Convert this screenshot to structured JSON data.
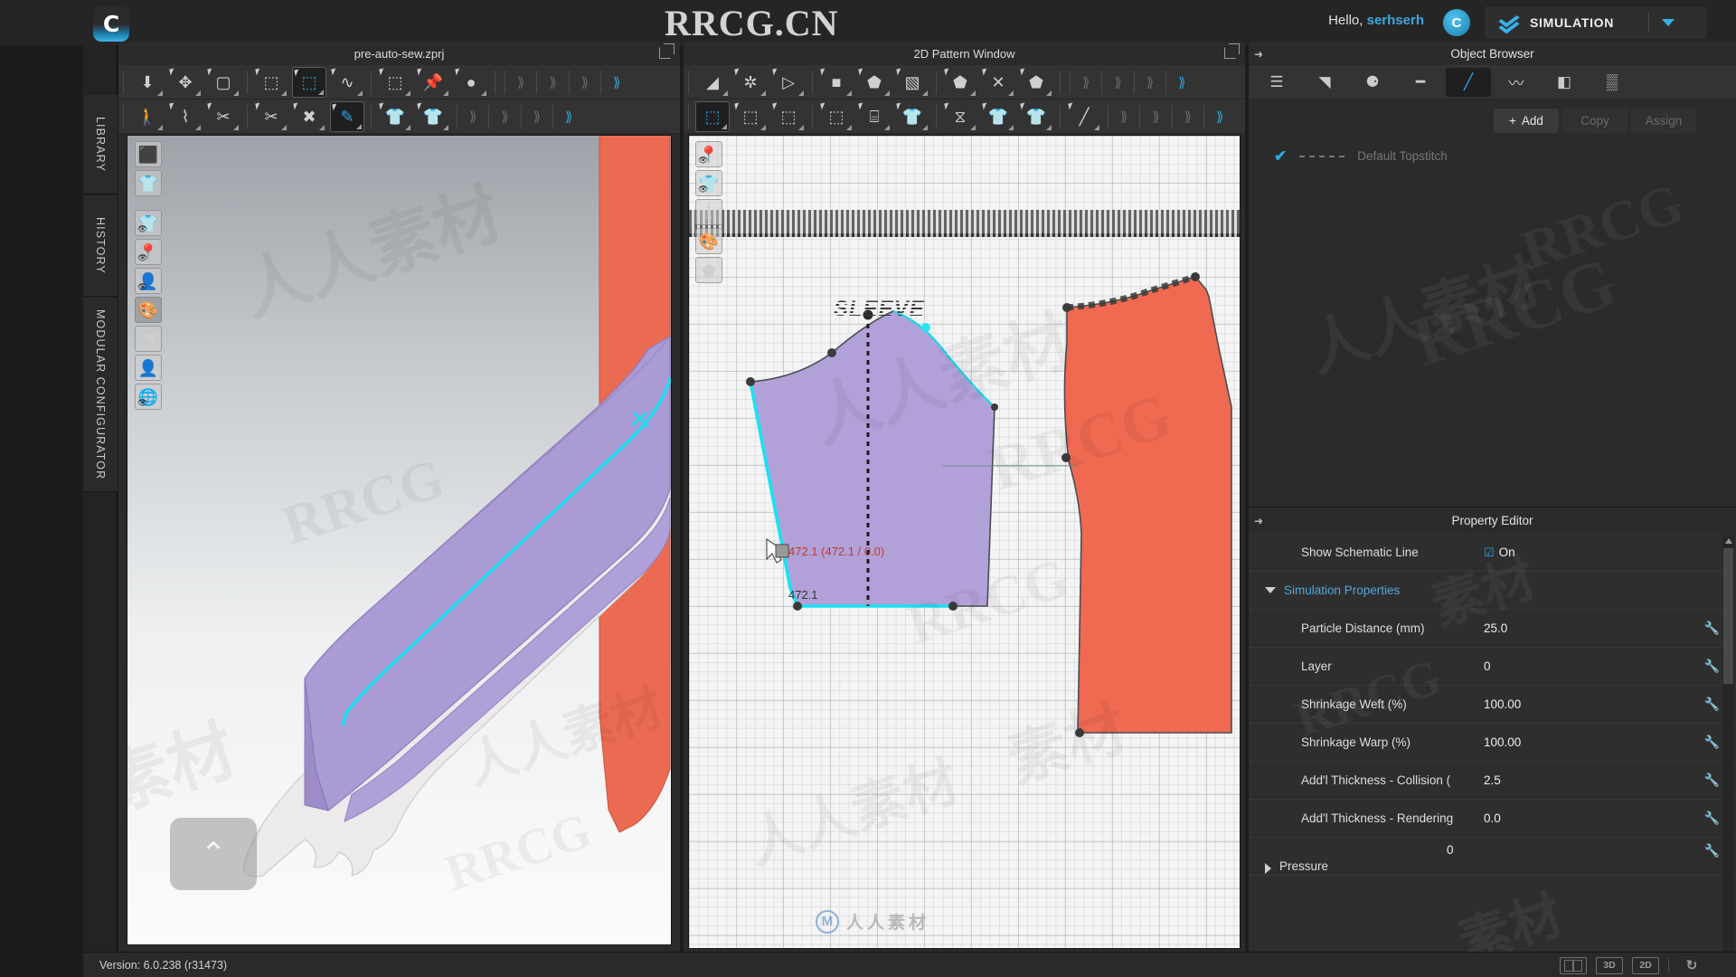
{
  "app": {
    "logo_glyph": "C",
    "greeting_prefix": "Hello,",
    "username": "serhserh",
    "avatar_glyph": "C",
    "simulation_label": "SIMULATION",
    "watermark_top": "RRCG.CN"
  },
  "left_rail": {
    "tabs": [
      {
        "label": "LIBRARY"
      },
      {
        "label": "HISTORY"
      },
      {
        "label": "MODULAR CONFIGURATOR"
      }
    ]
  },
  "panel_3d": {
    "title": "pre-auto-sew.zprj",
    "toolbar_row1": [
      {
        "name": "sync-import-icon",
        "glyph": "⬇"
      },
      {
        "name": "transform-move-icon",
        "glyph": "✥"
      },
      {
        "name": "select-box-icon",
        "glyph": "▢"
      },
      {
        "name": "edit-pattern-icon",
        "glyph": "⬚"
      },
      {
        "name": "segment-sewing-icon",
        "glyph": "⬚"
      },
      {
        "name": "free-sewing-icon",
        "glyph": "∿"
      },
      {
        "name": "fold-arrangement-icon",
        "glyph": "⬚"
      },
      {
        "name": "pin-icon",
        "glyph": "📌"
      },
      {
        "name": "tack-icon",
        "glyph": "●"
      }
    ],
    "toolbar_row2": [
      {
        "name": "avatar-pose-icon",
        "glyph": "🚶"
      },
      {
        "name": "zipper-icon",
        "glyph": "⌇"
      },
      {
        "name": "button-attach-icon",
        "glyph": "✂"
      },
      {
        "name": "trim-icon",
        "glyph": "✂"
      },
      {
        "name": "fabric-cut-icon",
        "glyph": "✖"
      },
      {
        "name": "brush-tool-icon",
        "glyph": "✎"
      },
      {
        "name": "texture-shirt-icon",
        "glyph": "👕"
      },
      {
        "name": "print-shirt-icon",
        "glyph": "👕"
      }
    ],
    "view_tools": [
      {
        "name": "sync-box-icon",
        "glyph": "⬛"
      },
      {
        "name": "show-garment-icon",
        "glyph": "👕"
      },
      {
        "name": "show-garment-toggle-icon",
        "glyph": "👕"
      },
      {
        "name": "show-pin-icon",
        "glyph": "📍"
      },
      {
        "name": "show-avatar-icon",
        "glyph": "👤"
      },
      {
        "name": "show-texture-icon",
        "glyph": "🎨"
      },
      {
        "name": "show-fabric-icon",
        "glyph": "◥"
      },
      {
        "name": "avatar-head-icon",
        "glyph": "👤"
      },
      {
        "name": "show-environment-icon",
        "glyph": "🌐"
      }
    ],
    "gizmo_glyph": "⌃"
  },
  "panel_2d": {
    "title": "2D Pattern Window",
    "toolbar_row1": [
      {
        "name": "edit-pattern-icon",
        "glyph": "◢"
      },
      {
        "name": "edit-curve-point-icon",
        "glyph": "✲"
      },
      {
        "name": "polygon-tool-icon",
        "glyph": "▷"
      },
      {
        "name": "rectangle-tool-icon",
        "glyph": "■"
      },
      {
        "name": "polygon-shape-icon",
        "glyph": "⬟"
      },
      {
        "name": "trace-icon",
        "glyph": "▧"
      },
      {
        "name": "inner-shape-icon",
        "glyph": "⬟"
      },
      {
        "name": "cut-sew-icon",
        "glyph": "✕"
      },
      {
        "name": "pattern-outline-icon",
        "glyph": "⬟"
      }
    ],
    "toolbar_row2": [
      {
        "name": "segment-sewing-icon",
        "glyph": "⬚"
      },
      {
        "name": "free-sewing-icon",
        "glyph": "⬚"
      },
      {
        "name": "check-sewing-icon",
        "glyph": "⬚"
      },
      {
        "name": "pin-location-icon",
        "glyph": "⬚"
      },
      {
        "name": "fold-iron-icon",
        "glyph": "⌸"
      },
      {
        "name": "texture-shirt-icon",
        "glyph": "👕"
      },
      {
        "name": "roll-fabric-icon",
        "glyph": "⧖"
      },
      {
        "name": "print-shirt-icon",
        "glyph": "👕"
      },
      {
        "name": "print-shirt2-icon",
        "glyph": "👕"
      },
      {
        "name": "line-tool-icon",
        "glyph": "╱"
      }
    ],
    "view_tools": [
      {
        "name": "show-pin-icon",
        "glyph": "📍"
      },
      {
        "name": "show-garment-icon",
        "glyph": "👕"
      },
      {
        "name": "show-info-icon",
        "glyph": "ℹ"
      },
      {
        "name": "show-texture-icon",
        "glyph": "🎨"
      },
      {
        "name": "show-pattern-icon",
        "glyph": "⬟"
      }
    ],
    "pattern_label": "SLEEVE",
    "measure_primary": "472.1 (472.1 / 0.0)",
    "measure_secondary": "472.1",
    "watermark_zh": "人人素材",
    "watermark_mark": "M"
  },
  "object_browser": {
    "title": "Object Browser",
    "tabs": [
      {
        "name": "list-view-icon",
        "glyph": "☰",
        "selected": false
      },
      {
        "name": "fabric-icon",
        "glyph": "◥",
        "selected": false
      },
      {
        "name": "button-icon",
        "glyph": "⚈",
        "selected": false
      },
      {
        "name": "buttonhole-icon",
        "glyph": "━",
        "selected": false
      },
      {
        "name": "topstitch-icon",
        "glyph": "╱",
        "selected": true
      },
      {
        "name": "elastic-icon",
        "glyph": "〰",
        "selected": false
      },
      {
        "name": "fold-icon",
        "glyph": "◧",
        "selected": false
      },
      {
        "name": "graphic-icon",
        "glyph": "▒",
        "selected": false
      }
    ],
    "actions": [
      {
        "name": "add-button",
        "label": "Add",
        "icon": "+",
        "enabled": true
      },
      {
        "name": "copy-button",
        "label": "Copy",
        "icon": "",
        "enabled": false
      },
      {
        "name": "assign-button",
        "label": "Assign",
        "icon": "",
        "enabled": false
      }
    ],
    "items": [
      {
        "name": "Default Topstitch",
        "checked": true
      }
    ]
  },
  "property_editor": {
    "title": "Property Editor",
    "schematic": {
      "label": "Show Schematic Line",
      "value": "On",
      "checked": true
    },
    "group": {
      "label": "Simulation Properties",
      "expanded": true
    },
    "rows": [
      {
        "label": "Particle Distance (mm)",
        "value": "25.0"
      },
      {
        "label": "Layer",
        "value": "0"
      },
      {
        "label": "Shrinkage Weft (%)",
        "value": "100.00"
      },
      {
        "label": "Shrinkage Warp (%)",
        "value": "100.00"
      },
      {
        "label": "Add'l Thickness - Collision (",
        "value": "2.5"
      },
      {
        "label": "Add'l Thickness - Rendering",
        "value": "0.0"
      }
    ],
    "collapsed_group": {
      "label": "Pressure",
      "value": "0",
      "expanded": false
    }
  },
  "status_bar": {
    "version": "Version: 6.0.238 (r31473)",
    "buttons": [
      {
        "name": "split-view-button",
        "label": ""
      },
      {
        "name": "view-3d-button",
        "label": "3D"
      },
      {
        "name": "view-2d-button",
        "label": "2D"
      },
      {
        "name": "reset-view-button",
        "label": "↻"
      }
    ]
  },
  "colors": {
    "accent": "#2aa8e2",
    "pattern_purple": "#b09cd8",
    "pattern_orange": "#ef6a51",
    "selection_cyan": "#12e6f5",
    "measure_red": "#c0392b",
    "panel_bg": "#2b2b2b"
  }
}
